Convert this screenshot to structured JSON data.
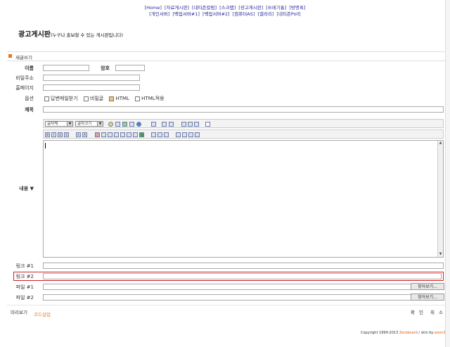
{
  "nav": {
    "row1": [
      "[Home]",
      "[자료게시판]",
      "[네티즌칼럼]",
      "[스크랩]",
      "[광고게시판]",
      "[쓰레기통]",
      "[방명록]"
    ],
    "row2": [
      "[개인서버]",
      "[백업서버#1]",
      "[백업서버#2]",
      "[컴퓨터AS]",
      "[갤러리]",
      "[네티즌Poll]"
    ]
  },
  "board": {
    "title": "광고게시판",
    "subtitle": "(누구나 홍보할 수 있는 게시판입니다)"
  },
  "write_bar": {
    "label": "새글쓰기"
  },
  "form": {
    "name_label": "이름",
    "password_label": "암호",
    "email_label": "비밀주소",
    "homepage_label": "홈페이지",
    "options_label": "옵션",
    "options": [
      "답변메일받기",
      "비밀글",
      "HTML",
      "HTML적용"
    ],
    "subject_label": "제목",
    "content_label": "내용 ▼",
    "link1_label": "링크 #1",
    "link2_label": "링크 #2",
    "file1_label": "파일 #1",
    "file2_label": "파일 #2",
    "browse_label": "찾아보기..."
  },
  "editor": {
    "font_select": "글자체",
    "size_select": "글자크기"
  },
  "footer": {
    "preview": "미리보기",
    "code_insert": "코드삽입",
    "confirm": "확 인",
    "cancel": "취 소",
    "copyright": "Copyright 1999-2013",
    "zeroboard": "Zeroboard",
    "skin_by": "/ skin by",
    "skin_author": "poon赤"
  },
  "colors": {
    "nav": "#2a2a9a",
    "zeroboard": "#e05a10",
    "code_insert": "#e07a1a",
    "highlight_border": "#d42020"
  }
}
